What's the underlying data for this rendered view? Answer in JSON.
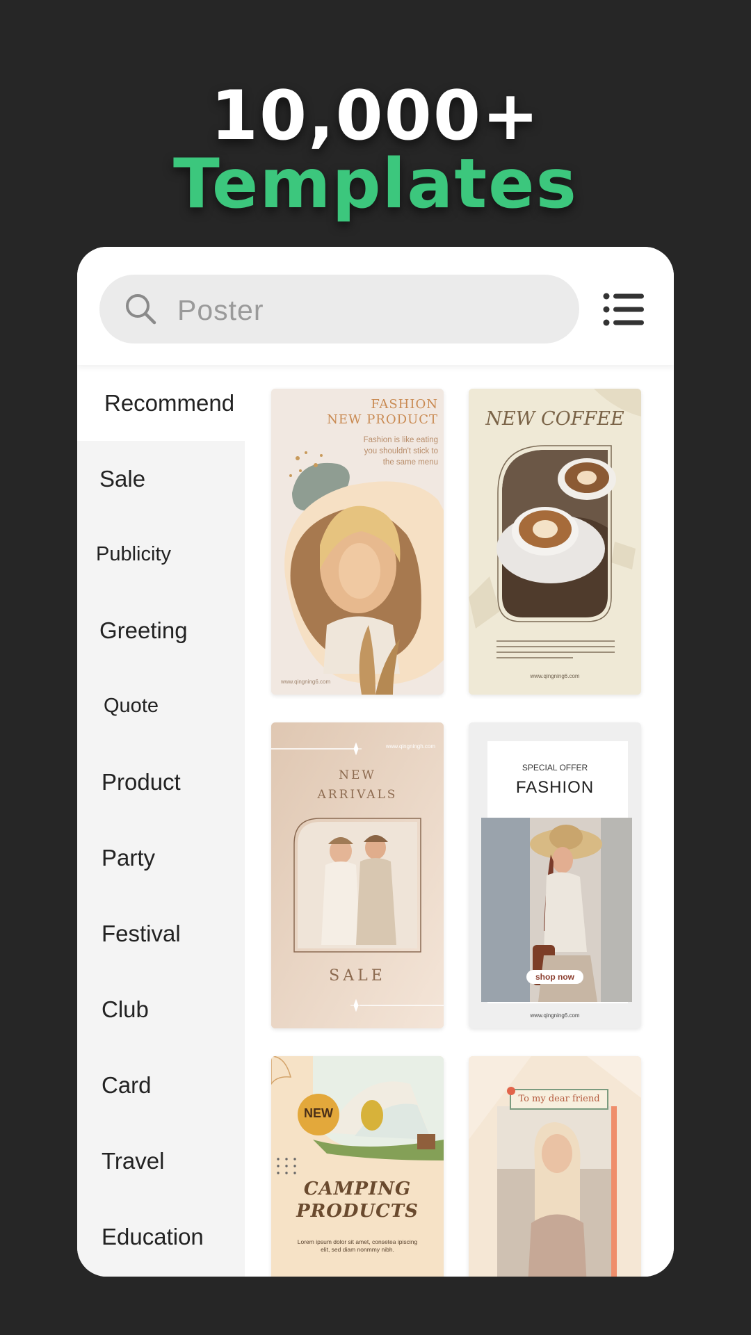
{
  "headline": {
    "part1": "10,000+",
    "part2": "Templates"
  },
  "search": {
    "placeholder": "Poster"
  },
  "sidebar": {
    "items": [
      {
        "label": "Recommend",
        "active": true
      },
      {
        "label": "Sale"
      },
      {
        "label": "Publicity"
      },
      {
        "label": "Greeting"
      },
      {
        "label": "Quote"
      },
      {
        "label": "Product"
      },
      {
        "label": "Party"
      },
      {
        "label": "Festival"
      },
      {
        "label": "Club"
      },
      {
        "label": "Card"
      },
      {
        "label": "Travel"
      },
      {
        "label": "Education"
      }
    ]
  },
  "templates": [
    {
      "title1": "FASHION",
      "title2": "NEW PRODUCT",
      "tagline": "Fashion is like eating you shouldn't stick to the same menu",
      "url": "www.qingning6.com"
    },
    {
      "title": "NEW COFFEE",
      "url": "www.qingning6.com"
    },
    {
      "title1": "NEW",
      "title2": "ARRIVALS",
      "sale": "SALE",
      "url": "www.qingningh.com"
    },
    {
      "kicker": "SPECIAL OFFER",
      "title": "FASHION",
      "cta": "shop now",
      "url": "www.qingning6.com"
    },
    {
      "badge": "NEW",
      "title1": "CAMPING",
      "title2": "PRODUCTS",
      "body": "Lorem ipsum dolor sit amet, consetea ipiscing elit, sed diam nonmmy nibh."
    },
    {
      "title": "To my dear friend"
    }
  ],
  "colors": {
    "accent": "#3cc77d",
    "background": "#262626"
  }
}
